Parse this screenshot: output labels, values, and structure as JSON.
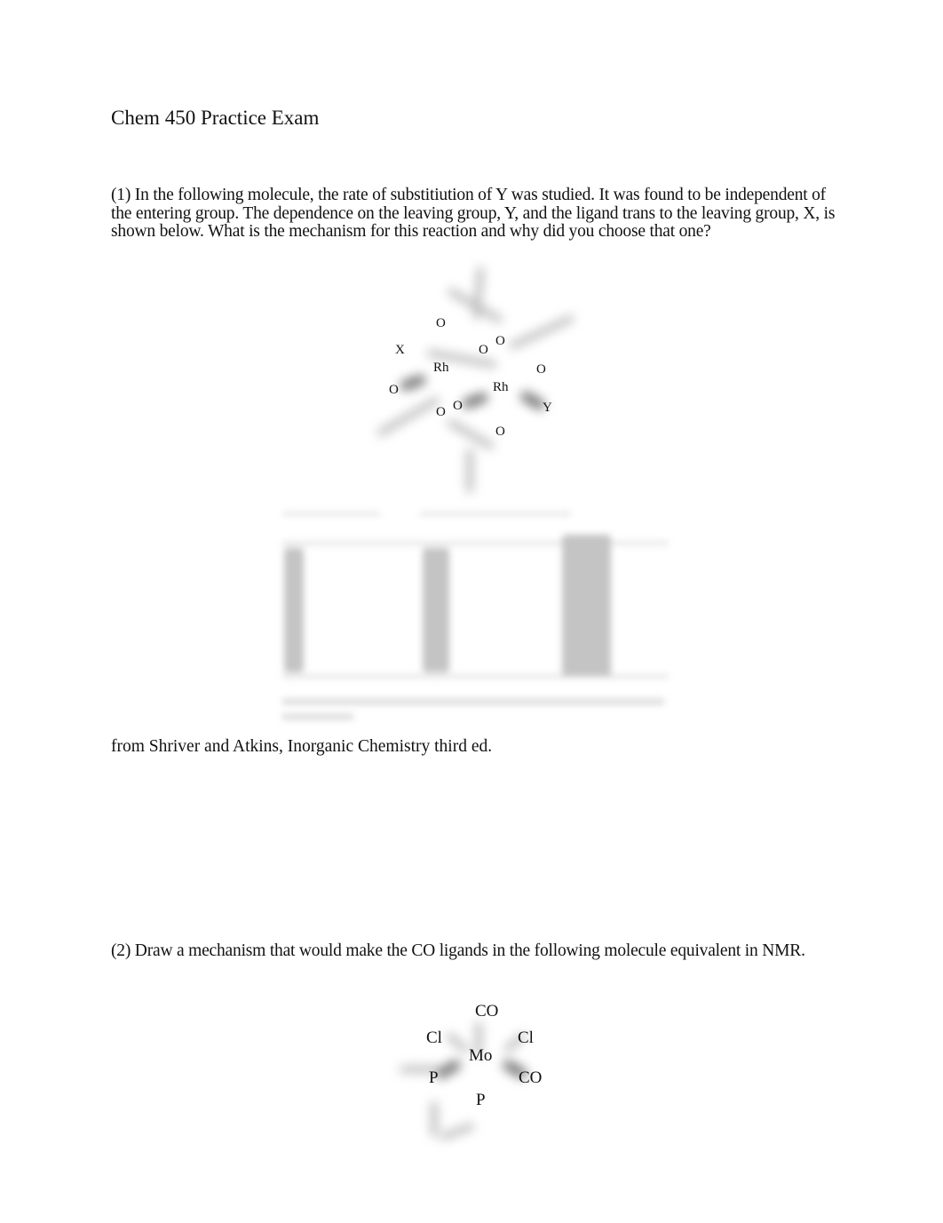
{
  "document": {
    "title": "Chem 450 Practice Exam",
    "question1": {
      "text": "(1)  In the following molecule, the rate of substitiution of Y was studied.   It was found to be independent of the entering group.  The dependence on the leaving group, Y, and the ligand trans to the leaving group, X, is shown below.    What is the mechanism for this reaction and why did you choose that one?",
      "molecule_labels": {
        "metal1": "Rh",
        "metal2": "Rh",
        "x": "X",
        "y": "Y",
        "oxygen": "O"
      },
      "table_note": "table image (illegible/blurred)",
      "source": "from Shriver and Atkins, Inorganic Chemistry  third ed."
    },
    "question2": {
      "text": "(2)  Draw a mechanism that would make the CO ligands in the following molecule equivalent in NMR.",
      "molecule_labels": {
        "metal": "Mo",
        "co_top": "CO",
        "co_right": "CO",
        "cl_left": "Cl",
        "cl_right": "Cl",
        "p_left": "P",
        "p_bottom": "P"
      }
    }
  }
}
